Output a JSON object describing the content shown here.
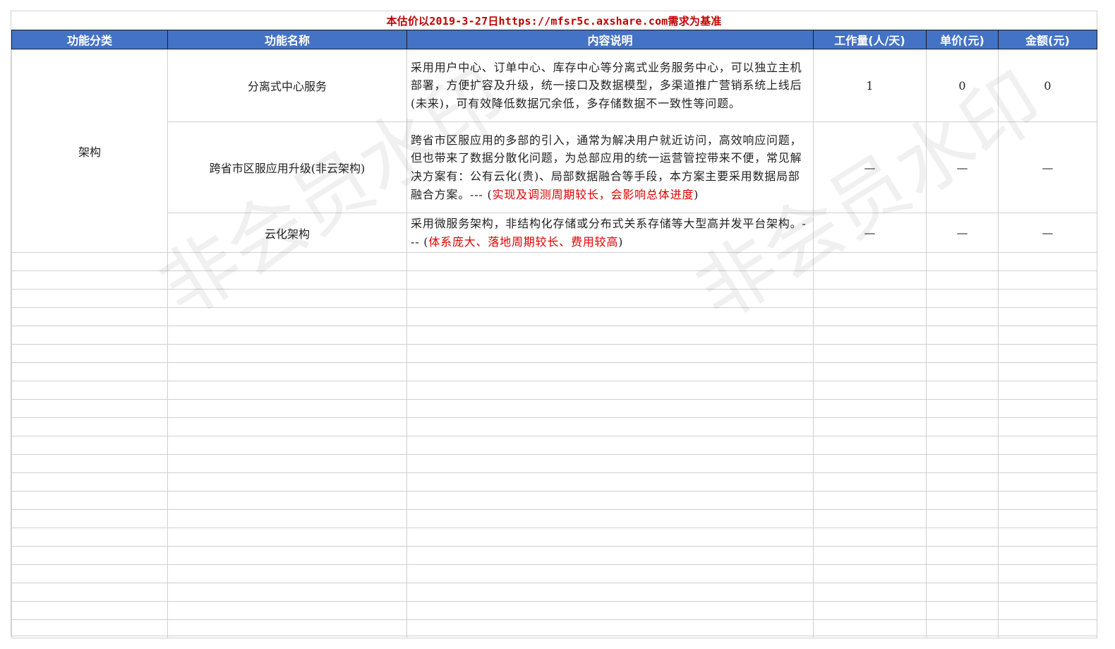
{
  "banner": "本估价以2019-3-27日https://mfsr5c.axshare.com需求为基准",
  "headers": {
    "category": "功能分类",
    "name": "功能名称",
    "desc": "内容说明",
    "workload": "工作量(人/天)",
    "price": "单价(元)",
    "amount": "金额(元)"
  },
  "category": "架构",
  "rows": [
    {
      "name": "分离式中心服务",
      "desc": "采用用户中心、订单中心、库存中心等分离式业务服务中心，可以独立主机部署，方便扩容及升级，统一接口及数据模型，多渠道推广营销系统上线后(未来)，可有效降低数据冗余低，多存储数据不一致性等问题。",
      "desc_note": "",
      "desc_tail": "",
      "workload": "1",
      "price": "0",
      "amount": "0"
    },
    {
      "name": "跨省市区服应用升级(非云架构)",
      "desc": "跨省市区服应用的多部的引入，通常为解决用户就近访问，高效响应问题，但也带来了数据分散化问题，为总部应用的统一运营管控带来不便，常见解决方案有：公有云化(贵)、局部数据融合等手段，本方案主要采用数据局部融合方案。--- (",
      "desc_note": "实现及调测周期较长，会影响总体进度",
      "desc_tail": ")",
      "workload": "—",
      "price": "—",
      "amount": "—"
    },
    {
      "name": "云化架构",
      "desc": "采用微服务架构，非结构化存储或分布式关系存储等大型高并发平台架构。--- (",
      "desc_note": "体系庞大、落地周期较长、费用较高",
      "desc_tail": ")",
      "workload": "—",
      "price": "—",
      "amount": "—"
    }
  ],
  "watermark": "非会员水印"
}
